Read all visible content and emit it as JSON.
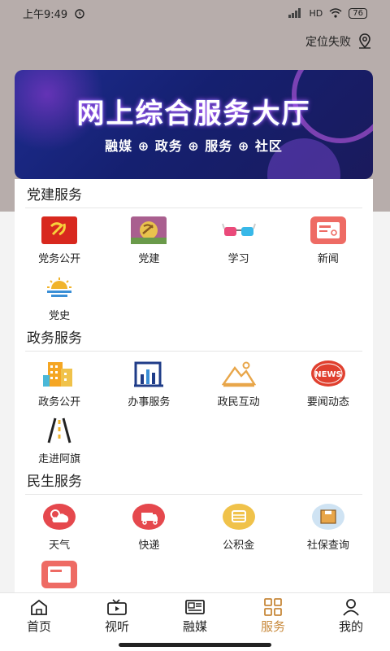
{
  "status_bar": {
    "time": "上午9:49",
    "signal": "HD",
    "battery": "76"
  },
  "location_text": "定位失败",
  "banner": {
    "title": "网上综合服务大厅",
    "subtitle": "融媒 ⊕ 政务 ⊕ 服务 ⊕ 社区"
  },
  "sections": [
    {
      "title": "党建服务",
      "items": [
        {
          "label": "党务公开",
          "icon": "party-flag-icon"
        },
        {
          "label": "党建",
          "icon": "party-emblem-icon"
        },
        {
          "label": "学习",
          "icon": "glasses-icon"
        },
        {
          "label": "新闻",
          "icon": "news-card-icon"
        },
        {
          "label": "党史",
          "icon": "sunrise-icon"
        }
      ]
    },
    {
      "title": "政务服务",
      "items": [
        {
          "label": "政务公开",
          "icon": "buildings-icon"
        },
        {
          "label": "办事服务",
          "icon": "office-chart-icon"
        },
        {
          "label": "政民互动",
          "icon": "mountain-picture-icon"
        },
        {
          "label": "要闻动态",
          "icon": "news-badge-icon"
        },
        {
          "label": "走进阿旗",
          "icon": "road-icon"
        }
      ]
    },
    {
      "title": "民生服务",
      "items": [
        {
          "label": "天气",
          "icon": "weather-icon"
        },
        {
          "label": "快递",
          "icon": "delivery-icon"
        },
        {
          "label": "公积金",
          "icon": "fund-icon"
        },
        {
          "label": "社保查询",
          "icon": "social-security-icon"
        }
      ]
    }
  ],
  "tabs": [
    {
      "label": "首页",
      "icon": "home-icon"
    },
    {
      "label": "视听",
      "icon": "video-icon"
    },
    {
      "label": "融媒",
      "icon": "newspaper-icon"
    },
    {
      "label": "服务",
      "icon": "grid-icon",
      "active": true
    },
    {
      "label": "我的",
      "icon": "user-icon"
    }
  ],
  "colors": {
    "accent": "#c7883a",
    "header_bg": "#b7adab",
    "banner_bg": "#1d2c8f"
  }
}
